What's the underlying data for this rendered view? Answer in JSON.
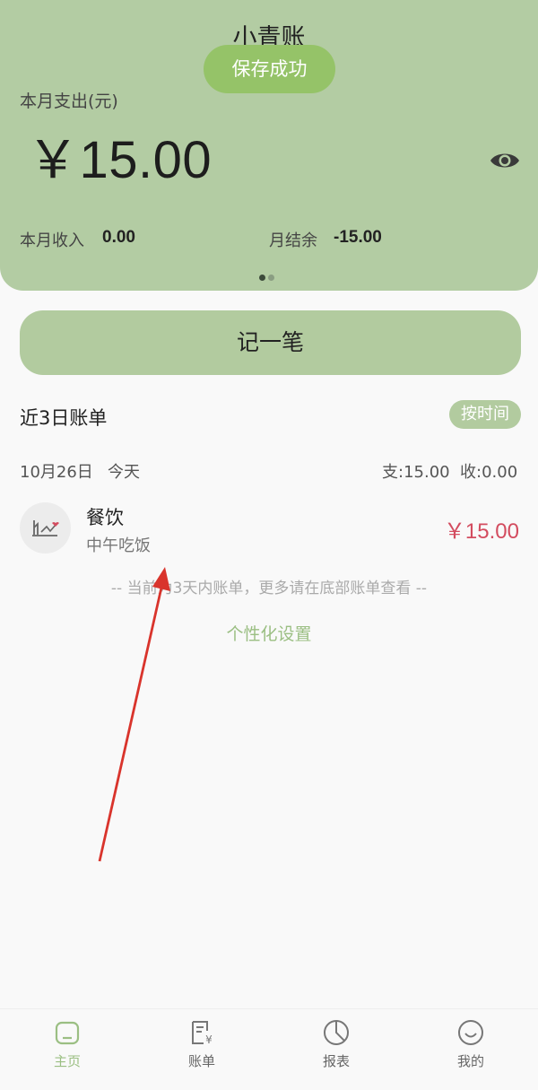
{
  "header": {
    "app_title": "小青账",
    "toast": "保存成功",
    "expense_label": "本月支出(元)",
    "expense_amount": "￥15.00",
    "eye_icon": "eye-icon",
    "income_label": "本月收入",
    "income_value": "0.00",
    "balance_label": "月结余",
    "balance_value": "-15.00"
  },
  "record_button": "记一笔",
  "recent": {
    "title": "近3日账单",
    "sort_label": "按时间",
    "date": "10月26日",
    "day_label": "今天",
    "day_expense": "支:15.00",
    "day_income": "收:0.00"
  },
  "entry": {
    "category": "餐饮",
    "note": "中午吃饭",
    "amount": "￥15.00",
    "icon": "dining-icon"
  },
  "hint": "-- 当前为3天内账单，更多请在底部账单查看 --",
  "personalize": "个性化设置",
  "tabs": [
    {
      "label": "主页",
      "icon": "home-icon"
    },
    {
      "label": "账单",
      "icon": "bill-icon"
    },
    {
      "label": "报表",
      "icon": "chart-icon"
    },
    {
      "label": "我的",
      "icon": "profile-icon"
    }
  ],
  "colors": {
    "header_bg": "#b3cca3",
    "accent": "#95c368",
    "expense": "#d34c5f"
  }
}
